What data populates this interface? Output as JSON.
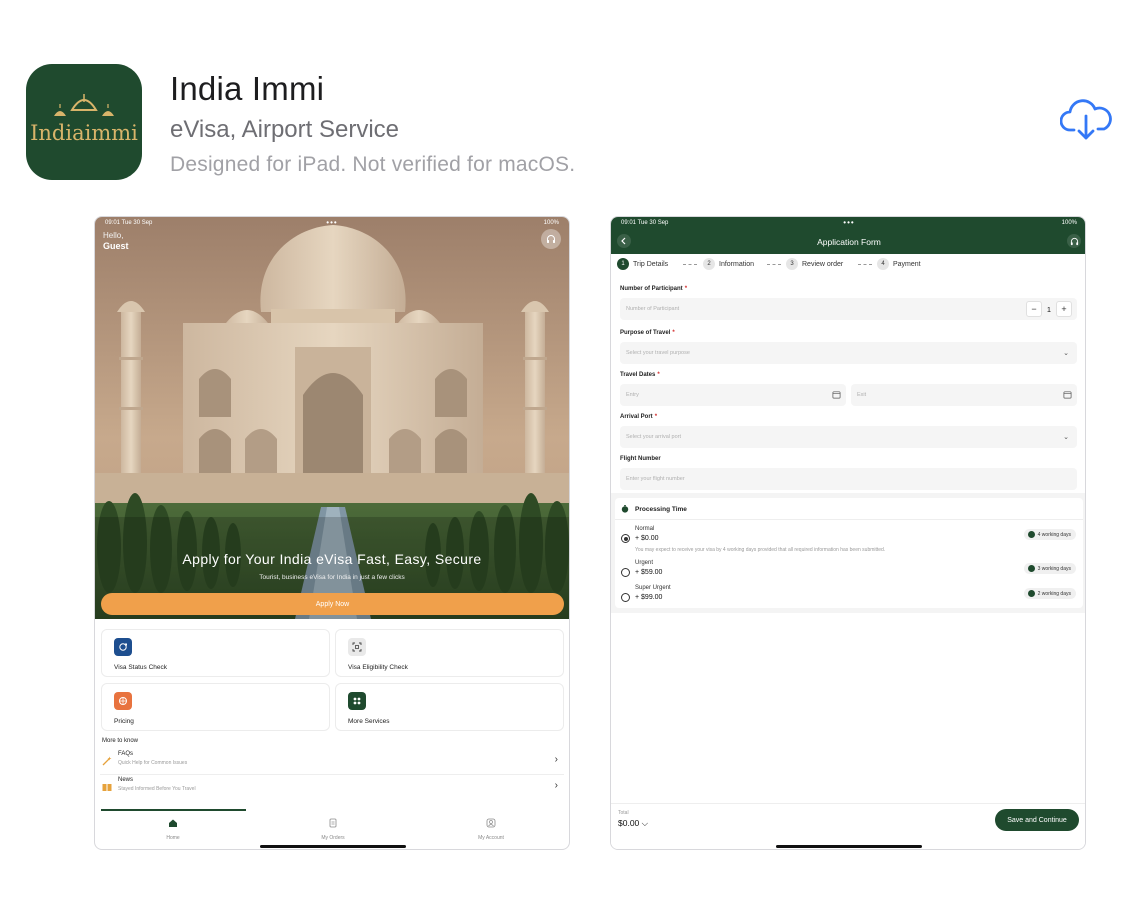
{
  "app": {
    "title": "India Immi",
    "subtitle": "eVisa, Airport Service",
    "note": "Designed for iPad. Not verified for macOS.",
    "icon_word": "Indiaimmi",
    "brand_color": "#1f4a2e",
    "accent_color": "#d8b46a"
  },
  "download": {
    "icon": "cloud-download-icon",
    "color": "#3478f6"
  },
  "screen1": {
    "status": {
      "time": "09:01  Tue 30 Sep",
      "dots": "•••",
      "battery": "100%"
    },
    "greeting": "Hello,",
    "user": "Guest",
    "hero_title": "Apply for Your India eVisa  Fast, Easy, Secure",
    "hero_subtitle": "Tourist, business eVisa for India in just a few clicks",
    "apply_label": "Apply Now",
    "apply_color": "#f0a04b",
    "cards": [
      {
        "label": "Visa Status Check",
        "icon": "refresh-icon",
        "color": "#1d4e8f"
      },
      {
        "label": "Visa Eligibility Check",
        "icon": "scan-icon",
        "color": "#e9e9e9"
      },
      {
        "label": "Pricing",
        "icon": "pricing-icon",
        "color": "#e8733f"
      },
      {
        "label": "More Services",
        "icon": "grid-icon",
        "color": "#1f4a2e"
      }
    ],
    "more_title": "More to know",
    "know": [
      {
        "title": "FAQs",
        "subtitle": "Quick Help for Common Issues",
        "icon": "magic-wand-icon"
      },
      {
        "title": "News",
        "subtitle": "Stayed Informed Before You Travel",
        "icon": "book-icon"
      }
    ],
    "tabs": [
      {
        "label": "Home",
        "icon": "home-icon"
      },
      {
        "label": "My Orders",
        "icon": "orders-icon"
      },
      {
        "label": "My Account",
        "icon": "account-icon"
      }
    ]
  },
  "screen2": {
    "status": {
      "time": "09:01  Tue 30 Sep",
      "dots": "•••",
      "battery": "100%"
    },
    "title": "Application Form",
    "steps": [
      {
        "num": "1",
        "label": "Trip Details"
      },
      {
        "num": "2",
        "label": "Information"
      },
      {
        "num": "3",
        "label": "Review order"
      },
      {
        "num": "4",
        "label": "Payment"
      }
    ],
    "fields": {
      "participants": {
        "label": "Number of Participant",
        "placeholder": "Number of Participant",
        "value": "1",
        "minus": "−",
        "plus": "+"
      },
      "purpose": {
        "label": "Purpose of Travel",
        "placeholder": "Select your travel purpose"
      },
      "dates": {
        "label": "Travel Dates",
        "entry": "Entry",
        "exit": "Exit"
      },
      "port": {
        "label": "Arrival Port",
        "placeholder": "Select your arrival port"
      },
      "flight": {
        "label": "Flight Number",
        "placeholder": "Enter your flight number"
      }
    },
    "required_mark": "*",
    "processing": {
      "title": "Processing Time",
      "options": [
        {
          "name": "Normal",
          "price": "+ $0.00",
          "days": "4 working days",
          "selected": true,
          "desc": "You may expect to receive your visa by 4 working days provided that all required information has been submitted."
        },
        {
          "name": "Urgent",
          "price": "+ $59.00",
          "days": "3 working days",
          "selected": false
        },
        {
          "name": "Super Urgent",
          "price": "+ $99.00",
          "days": "2 working days",
          "selected": false
        }
      ]
    },
    "total_label": "Total",
    "total_value": "$0.00 ⌵",
    "save_label": "Save and Continue"
  }
}
